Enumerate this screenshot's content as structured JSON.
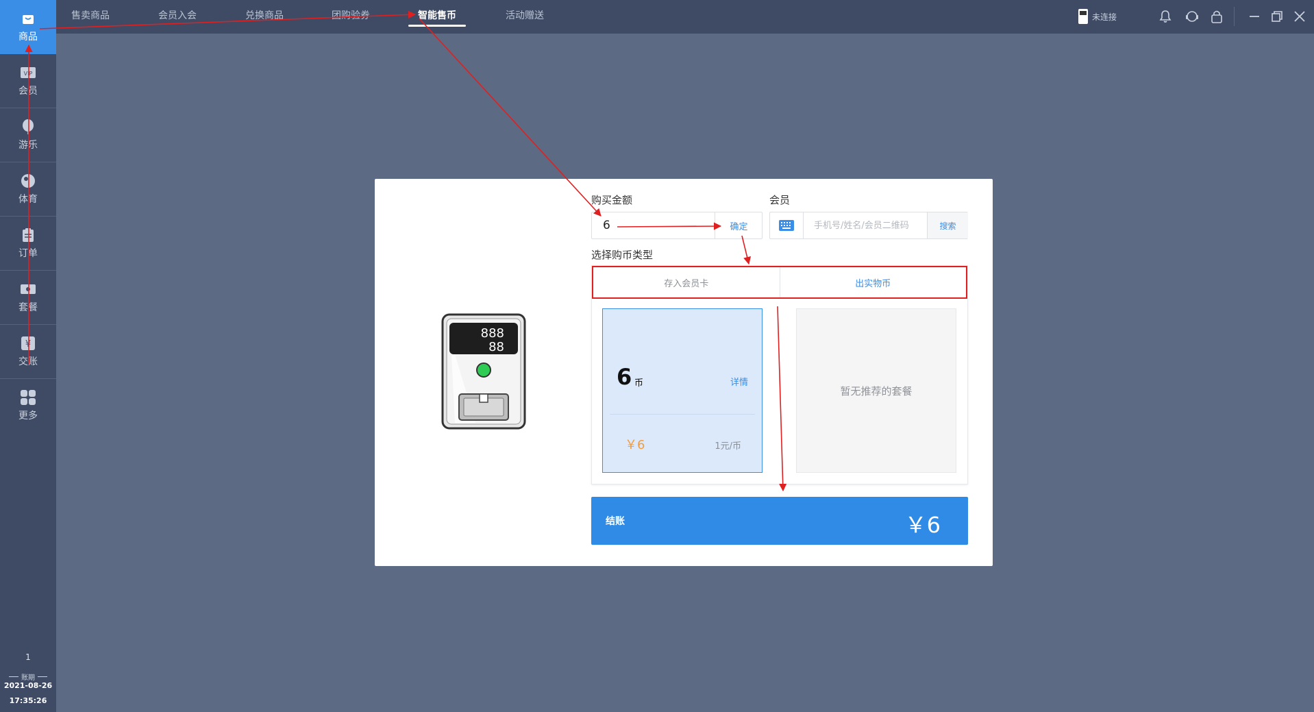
{
  "sidebar": {
    "items": [
      {
        "label": "商品",
        "icon": "bag-icon"
      },
      {
        "label": "会员",
        "icon": "vip-card-icon"
      },
      {
        "label": "游乐",
        "icon": "balloon-icon"
      },
      {
        "label": "体育",
        "icon": "ball-icon"
      },
      {
        "label": "订单",
        "icon": "clipboard-icon"
      },
      {
        "label": "套餐",
        "icon": "ticket-icon"
      },
      {
        "label": "交账",
        "icon": "yen-icon"
      },
      {
        "label": "更多",
        "icon": "grid-icon"
      }
    ],
    "page": "1",
    "period_label": "账期",
    "date": "2021-08-26",
    "time": "17:35:26"
  },
  "topbar": {
    "tabs": [
      {
        "label": "售卖商品"
      },
      {
        "label": "会员入会"
      },
      {
        "label": "兑换商品"
      },
      {
        "label": "团购验券"
      },
      {
        "label": "智能售币"
      },
      {
        "label": "活动赠送"
      }
    ],
    "active_tab": "智能售币",
    "connection_status": "未连接"
  },
  "dialog": {
    "amount_label": "购买金额",
    "amount_value": "6",
    "confirm_label": "确定",
    "member_label": "会员",
    "member_placeholder": "手机号/姓名/会员二维码",
    "search_label": "搜索",
    "type_label": "选择购币类型",
    "type_tabs": [
      {
        "label": "存入会员卡",
        "selected": false
      },
      {
        "label": "出实物币",
        "selected": true
      }
    ],
    "package": {
      "coins": "6",
      "coin_unit": "币",
      "detail_label": "详情",
      "price": "￥6",
      "rate": "1元/币"
    },
    "empty_text": "暂无推荐的套餐",
    "machine": {
      "display_line1": "888",
      "display_line2": "88"
    },
    "checkout_label": "结账",
    "checkout_amount": "￥6"
  },
  "colors": {
    "accent": "#3a8ee6",
    "sidebar_bg": "#3f4b65",
    "page_bg": "#5d6a83",
    "price_orange": "#f39c3a",
    "annotation_red": "#e02020"
  }
}
